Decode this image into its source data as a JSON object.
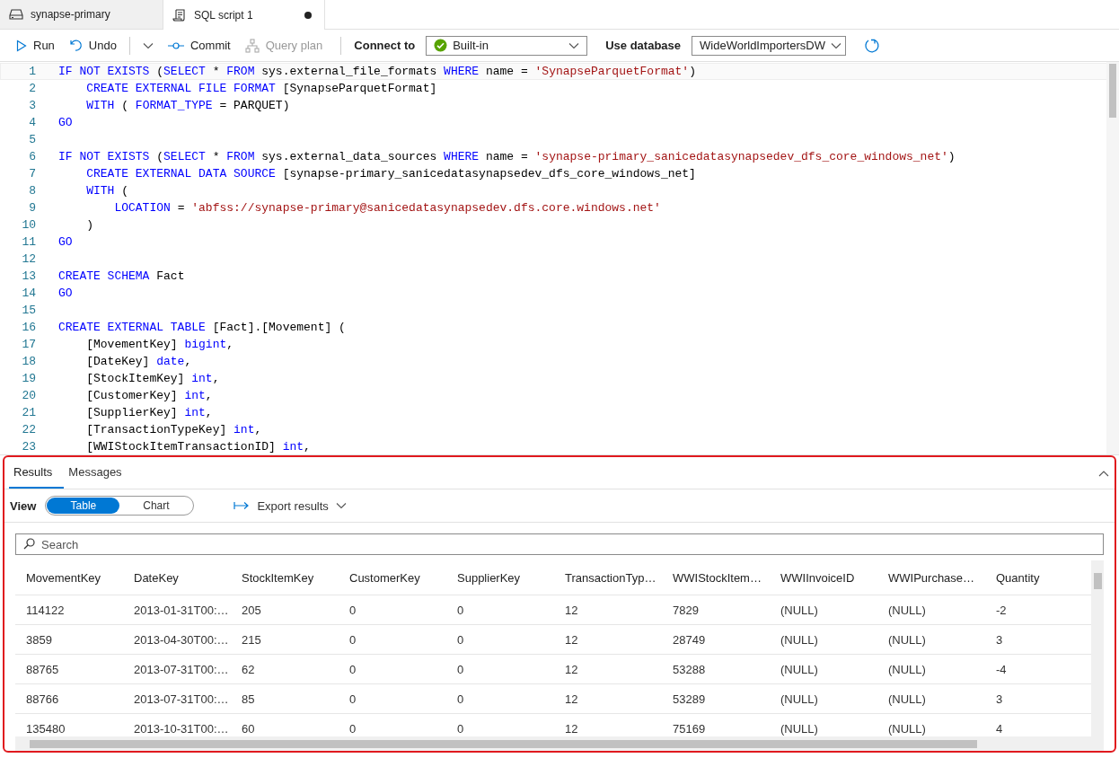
{
  "tabs": [
    {
      "label": "synapse-primary",
      "kind": "database",
      "selected": false,
      "modified": false
    },
    {
      "label": "SQL script 1",
      "kind": "script",
      "selected": true,
      "modified": true
    }
  ],
  "toolbar": {
    "buttons": [
      {
        "label": "Run",
        "kind": "run",
        "disabled": false,
        "split": false
      },
      {
        "label": "Undo",
        "kind": "undo",
        "disabled": false,
        "split": true
      },
      {
        "label": "Commit",
        "kind": "commit",
        "disabled": false,
        "split": false
      },
      {
        "label": "Query plan",
        "kind": "plan",
        "disabled": true,
        "split": false
      }
    ],
    "connect": {
      "label": "Connect to",
      "value": "Built-in"
    },
    "database": {
      "label": "Use database",
      "value": "WideWorldImportersDW"
    }
  },
  "editor": {
    "lines": [
      {
        "number": "1",
        "segments": [
          {
            "kind": "keyword",
            "text": "IF NOT EXISTS"
          },
          {
            "kind": "plain",
            "text": " ("
          },
          {
            "kind": "keyword",
            "text": "SELECT"
          },
          {
            "kind": "plain",
            "text": " * "
          },
          {
            "kind": "keyword",
            "text": "FROM"
          },
          {
            "kind": "plain",
            "text": " sys.external_file_formats "
          },
          {
            "kind": "keyword",
            "text": "WHERE"
          },
          {
            "kind": "plain",
            "text": " name = "
          },
          {
            "kind": "string",
            "text": "'SynapseParquetFormat'"
          },
          {
            "kind": "plain",
            "text": ")"
          }
        ]
      },
      {
        "number": "2",
        "segments": [
          {
            "kind": "keyword",
            "text": "    CREATE EXTERNAL FILE FORMAT"
          },
          {
            "kind": "plain",
            "text": " [SynapseParquetFormat]"
          }
        ]
      },
      {
        "number": "3",
        "segments": [
          {
            "kind": "keyword",
            "text": "    WITH"
          },
          {
            "kind": "plain",
            "text": " ( "
          },
          {
            "kind": "keyword",
            "text": "FORMAT_TYPE"
          },
          {
            "kind": "plain",
            "text": " = PARQUET)"
          }
        ]
      },
      {
        "number": "4",
        "segments": [
          {
            "kind": "keyword",
            "text": "GO"
          }
        ]
      },
      {
        "number": "5"
      },
      {
        "number": "6",
        "segments": [
          {
            "kind": "keyword",
            "text": "IF NOT EXISTS"
          },
          {
            "kind": "plain",
            "text": " ("
          },
          {
            "kind": "keyword",
            "text": "SELECT"
          },
          {
            "kind": "plain",
            "text": " * "
          },
          {
            "kind": "keyword",
            "text": "FROM"
          },
          {
            "kind": "plain",
            "text": " sys.external_data_sources "
          },
          {
            "kind": "keyword",
            "text": "WHERE"
          },
          {
            "kind": "plain",
            "text": " name = "
          },
          {
            "kind": "string",
            "text": "'synapse-primary_sanicedatasynapsedev_dfs_core_windows_net'"
          },
          {
            "kind": "plain",
            "text": ")"
          }
        ]
      },
      {
        "number": "7",
        "segments": [
          {
            "kind": "keyword",
            "text": "    CREATE EXTERNAL DATA SOURCE"
          },
          {
            "kind": "plain",
            "text": " [synapse-primary_sanicedatasynapsedev_dfs_core_windows_net]"
          }
        ]
      },
      {
        "number": "8",
        "segments": [
          {
            "kind": "keyword",
            "text": "    WITH"
          },
          {
            "kind": "plain",
            "text": " ("
          }
        ]
      },
      {
        "number": "9",
        "segments": [
          {
            "kind": "keyword",
            "text": "        LOCATION"
          },
          {
            "kind": "plain",
            "text": " = "
          },
          {
            "kind": "string",
            "text": "'abfss://synapse-primary@sanicedatasynapsedev.dfs.core.windows.net'"
          }
        ]
      },
      {
        "number": "10",
        "segments": [
          {
            "kind": "plain",
            "text": "    )"
          }
        ]
      },
      {
        "number": "11",
        "segments": [
          {
            "kind": "keyword",
            "text": "GO"
          }
        ]
      },
      {
        "number": "12"
      },
      {
        "number": "13",
        "segments": [
          {
            "kind": "keyword",
            "text": "CREATE SCHEMA"
          },
          {
            "kind": "plain",
            "text": " Fact"
          }
        ]
      },
      {
        "number": "14",
        "segments": [
          {
            "kind": "keyword",
            "text": "GO"
          }
        ]
      },
      {
        "number": "15"
      },
      {
        "number": "16",
        "segments": [
          {
            "kind": "keyword",
            "text": "CREATE EXTERNAL TABLE"
          },
          {
            "kind": "plain",
            "text": " [Fact].[Movement] ("
          }
        ]
      },
      {
        "number": "17",
        "segments": [
          {
            "kind": "plain",
            "text": "    [MovementKey] "
          },
          {
            "kind": "keyword",
            "text": "bigint"
          },
          {
            "kind": "plain",
            "text": ","
          }
        ]
      },
      {
        "number": "18",
        "segments": [
          {
            "kind": "plain",
            "text": "    [DateKey] "
          },
          {
            "kind": "keyword",
            "text": "date"
          },
          {
            "kind": "plain",
            "text": ","
          }
        ]
      },
      {
        "number": "19",
        "segments": [
          {
            "kind": "plain",
            "text": "    [StockItemKey] "
          },
          {
            "kind": "keyword",
            "text": "int"
          },
          {
            "kind": "plain",
            "text": ","
          }
        ]
      },
      {
        "number": "20",
        "segments": [
          {
            "kind": "plain",
            "text": "    [CustomerKey] "
          },
          {
            "kind": "keyword",
            "text": "int"
          },
          {
            "kind": "plain",
            "text": ","
          }
        ]
      },
      {
        "number": "21",
        "segments": [
          {
            "kind": "plain",
            "text": "    [SupplierKey] "
          },
          {
            "kind": "keyword",
            "text": "int"
          },
          {
            "kind": "plain",
            "text": ","
          }
        ]
      },
      {
        "number": "22",
        "segments": [
          {
            "kind": "plain",
            "text": "    [TransactionTypeKey] "
          },
          {
            "kind": "keyword",
            "text": "int"
          },
          {
            "kind": "plain",
            "text": ","
          }
        ]
      },
      {
        "number": "23",
        "segments": [
          {
            "kind": "plain",
            "text": "    [WWIStockItemTransactionID] "
          },
          {
            "kind": "keyword",
            "text": "int"
          },
          {
            "kind": "plain",
            "text": ","
          }
        ]
      }
    ]
  },
  "results": {
    "tabs": [
      {
        "label": "Results",
        "selected": true
      },
      {
        "label": "Messages",
        "selected": false
      }
    ],
    "view": {
      "label": "View",
      "options": [
        {
          "label": "Table",
          "selected": true
        },
        {
          "label": "Chart",
          "selected": false
        }
      ]
    },
    "export": "Export results",
    "search": {
      "placeholder": "Search"
    },
    "table": {
      "columns": [
        "MovementKey",
        "DateKey",
        "StockItemKey",
        "CustomerKey",
        "SupplierKey",
        "TransactionTyp…",
        "WWIStockItem…",
        "WWIInvoiceID",
        "WWIPurchase…",
        "Quantity"
      ],
      "rows": [
        [
          "114122",
          "2013-01-31T00:…",
          "205",
          "0",
          "0",
          "12",
          "7829",
          "(NULL)",
          "(NULL)",
          "-2"
        ],
        [
          "3859",
          "2013-04-30T00:…",
          "215",
          "0",
          "0",
          "12",
          "28749",
          "(NULL)",
          "(NULL)",
          "3"
        ],
        [
          "88765",
          "2013-07-31T00:…",
          "62",
          "0",
          "0",
          "12",
          "53288",
          "(NULL)",
          "(NULL)",
          "-4"
        ],
        [
          "88766",
          "2013-07-31T00:…",
          "85",
          "0",
          "0",
          "12",
          "53289",
          "(NULL)",
          "(NULL)",
          "3"
        ],
        [
          "135480",
          "2013-10-31T00:…",
          "60",
          "0",
          "0",
          "12",
          "75169",
          "(NULL)",
          "(NULL)",
          "4"
        ]
      ]
    }
  }
}
